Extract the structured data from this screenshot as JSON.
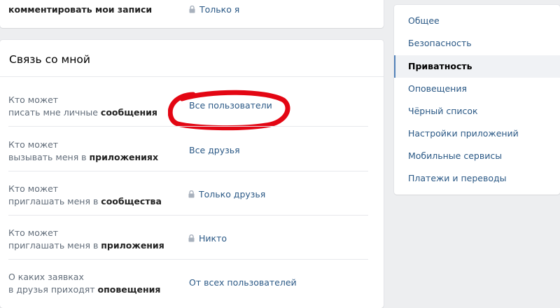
{
  "top_section": {
    "label_line2": "комментировать мои записи",
    "value": "Только я",
    "value_icon": "lock-icon"
  },
  "contact_section": {
    "title": "Связь со мной",
    "rows": [
      {
        "label_line1": "Кто может",
        "label_line2_plain": "писать мне личные ",
        "label_line2_bold": "сообщения",
        "value": "Все пользователи",
        "locked": false
      },
      {
        "label_line1": "Кто может",
        "label_line2_plain": "вызывать меня в ",
        "label_line2_bold": "приложениях",
        "value": "Все друзья",
        "locked": false
      },
      {
        "label_line1": "Кто может",
        "label_line2_plain": "приглашать меня в ",
        "label_line2_bold": "сообщества",
        "value": "Только друзья",
        "locked": true
      },
      {
        "label_line1": "Кто может",
        "label_line2_plain": "приглашать меня в ",
        "label_line2_bold": "приложения",
        "value": "Никто",
        "locked": true
      },
      {
        "label_line1": "О каких заявках",
        "label_line2_plain": "в друзья приходят ",
        "label_line2_bold": "оповещения",
        "value": "От всех пользователей",
        "locked": false
      }
    ],
    "annotation_color": "#e30613"
  },
  "settings_nav": {
    "items": [
      {
        "label": "Общее",
        "active": false
      },
      {
        "label": "Безопасность",
        "active": false
      },
      {
        "label": "Приватность",
        "active": true
      },
      {
        "label": "Оповещения",
        "active": false
      },
      {
        "label": "Чёрный список",
        "active": false
      },
      {
        "label": "Настройки приложений",
        "active": false
      },
      {
        "label": "Мобильные сервисы",
        "active": false
      },
      {
        "label": "Платежи и переводы",
        "active": false
      }
    ]
  },
  "colors": {
    "page_background": "#edeef0",
    "link": "#2a5885",
    "accent": "#5181b8"
  }
}
